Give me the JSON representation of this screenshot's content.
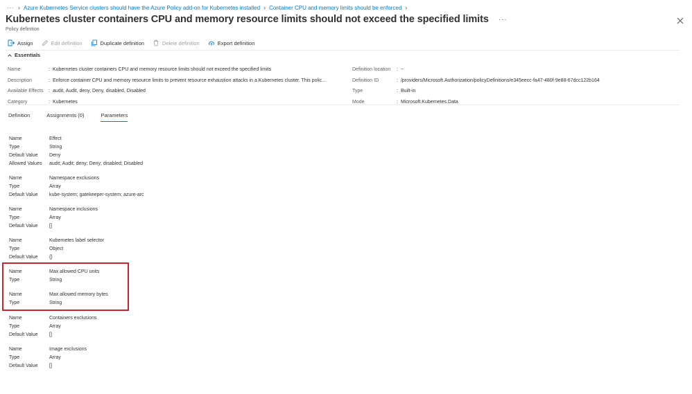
{
  "breadcrumb": {
    "more": "···",
    "items": [
      "Azure Kubernetes Service clusters should have the Azure Policy add-on for Kubernetes installed",
      "Container CPU and memory limits should be enforced"
    ]
  },
  "page": {
    "title": "Kubernetes cluster containers CPU and memory resource limits should not exceed the specified limits",
    "subtitle": "Policy definition",
    "more": "···"
  },
  "toolbar": {
    "assign": "Assign",
    "edit": "Edit definition",
    "duplicate": "Duplicate definition",
    "delete": "Delete definition",
    "export": "Export definition"
  },
  "essentials": {
    "label": "Essentials",
    "left": [
      {
        "key": "Name",
        "value": "Kubernetes cluster containers CPU and memory resource limits should not exceed the specified limits"
      },
      {
        "key": "Description",
        "value": "Enforce container CPU and memory resource limits to prevent resource exhaustion attacks in a Kubernetes cluster. This polic..."
      },
      {
        "key": "Available Effects",
        "value": "audit, Audit, deny, Deny, disabled, Disabled"
      },
      {
        "key": "Category",
        "value": "Kubernetes"
      }
    ],
    "right": [
      {
        "key": "Definition location",
        "value": "--"
      },
      {
        "key": "Definition ID",
        "value": "/providers/Microsoft.Authorization/policyDefinitions/e345eecc-fa47-480f-9e88-67dcc122b164"
      },
      {
        "key": "Type",
        "value": "Built-in"
      },
      {
        "key": "Mode",
        "value": "Microsoft.Kubernetes.Data"
      }
    ]
  },
  "tabs": {
    "definition": "Definition",
    "assignments": "Assignments (0)",
    "parameters": "Parameters"
  },
  "parameters": [
    {
      "rows": [
        {
          "key": "Name",
          "value": "Effect"
        },
        {
          "key": "Type",
          "value": "String"
        },
        {
          "key": "Default Value",
          "value": "Deny"
        },
        {
          "key": "Allowed Values",
          "value": "audit; Audit; deny; Deny; disabled; Disabled"
        }
      ]
    },
    {
      "rows": [
        {
          "key": "Name",
          "value": "Namespace exclusions"
        },
        {
          "key": "Type",
          "value": "Array"
        },
        {
          "key": "Default Value",
          "value": "kube-system; gatekeeper-system; azure-arc"
        }
      ]
    },
    {
      "rows": [
        {
          "key": "Name",
          "value": "Namespace inclusions"
        },
        {
          "key": "Type",
          "value": "Array"
        },
        {
          "key": "Default Value",
          "value": "[]"
        }
      ]
    },
    {
      "rows": [
        {
          "key": "Name",
          "value": "Kubernetes label selector"
        },
        {
          "key": "Type",
          "value": "Object"
        },
        {
          "key": "Default Value",
          "value": "{}"
        }
      ]
    },
    {
      "rows": [
        {
          "key": "Name",
          "value": "Max allowed CPU units"
        },
        {
          "key": "Type",
          "value": "String"
        }
      ]
    },
    {
      "rows": [
        {
          "key": "Name",
          "value": "Max allowed memory bytes"
        },
        {
          "key": "Type",
          "value": "String"
        }
      ]
    },
    {
      "rows": [
        {
          "key": "Name",
          "value": "Containers exclusions"
        },
        {
          "key": "Type",
          "value": "Array"
        },
        {
          "key": "Default Value",
          "value": "[]"
        }
      ]
    },
    {
      "rows": [
        {
          "key": "Name",
          "value": "Image exclusions"
        },
        {
          "key": "Type",
          "value": "Array"
        },
        {
          "key": "Default Value",
          "value": "[]"
        }
      ]
    }
  ],
  "colors": {
    "link": "#0078d4",
    "highlight": "#c4262e",
    "text": "#323130",
    "muted": "#605e5c"
  }
}
